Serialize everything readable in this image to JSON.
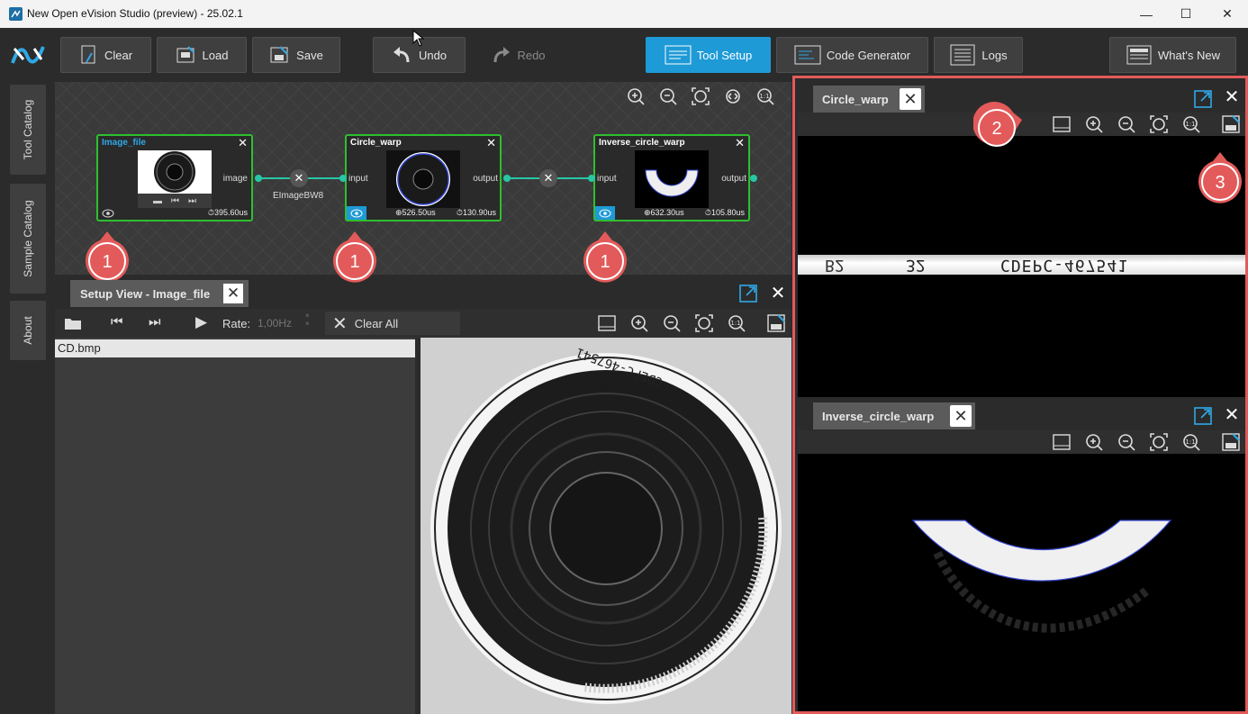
{
  "window": {
    "title": "New Open eVision Studio (preview) - 25.02.1",
    "minimize": "—",
    "maximize": "☐",
    "close": "✕"
  },
  "toolbar": {
    "clear": "Clear",
    "load": "Load",
    "save": "Save",
    "undo": "Undo",
    "redo": "Redo",
    "tool_setup": "Tool Setup",
    "code_generator": "Code Generator",
    "logs": "Logs",
    "whats_new": "What's New"
  },
  "sidebar": {
    "tool_catalog": "Tool Catalog",
    "sample_catalog": "Sample Catalog",
    "about": "About"
  },
  "graph": {
    "nodes": [
      {
        "title": "Image_file",
        "output_port": "image",
        "time1": "",
        "time2": "395.60us"
      },
      {
        "title": "Circle_warp",
        "input_port": "input",
        "output_port": "output",
        "time1": "526.50us",
        "time2": "130.90us"
      },
      {
        "title": "Inverse_circle_warp",
        "input_port": "input",
        "output_port": "output",
        "time1": "632.30us",
        "time2": "105.80us"
      }
    ],
    "connection_label": "EImageBW8",
    "callouts": [
      "1",
      "1",
      "1"
    ]
  },
  "setup_view": {
    "tab_title": "Setup View - Image_file",
    "rate_label": "Rate:",
    "rate_value": "1,00Hz",
    "clear_all": "Clear All",
    "files": [
      "CD.bmp"
    ]
  },
  "right_panels": {
    "panel1_title": "Circle_warp",
    "panel2_title": "Inverse_circle_warp",
    "callout2": "2",
    "callout3": "3",
    "strip_text": "CDEPC-467541",
    "strip_text_2": "32",
    "strip_text_3": "B2"
  },
  "colors": {
    "accent": "#1e9ad6",
    "node_border": "#2fbf2f",
    "port": "#27c7a5",
    "callout": "#e35a5a"
  }
}
